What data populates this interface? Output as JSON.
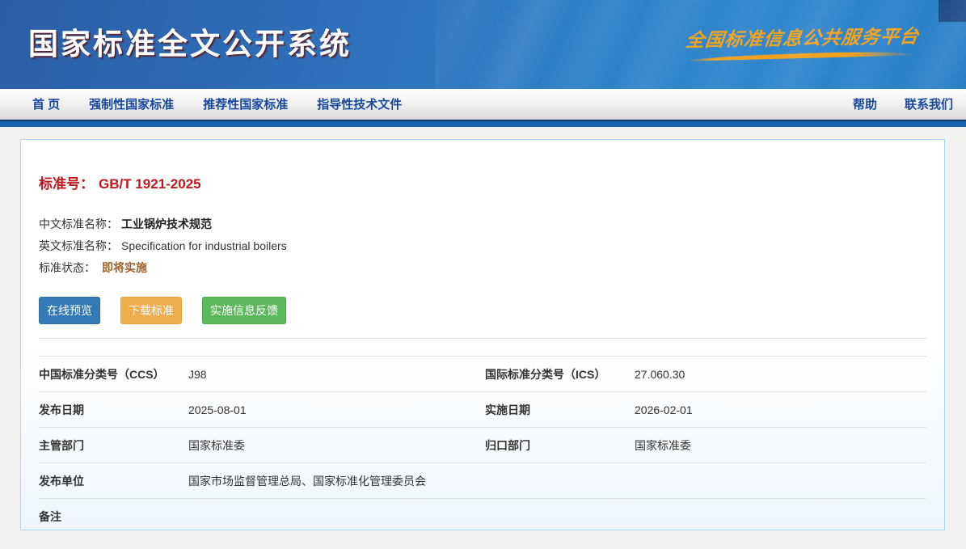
{
  "header": {
    "title": "国家标准全文公开系统",
    "platform_logo": "全国标准信息公共服务平台"
  },
  "nav": {
    "items": [
      {
        "label": "首 页"
      },
      {
        "label": "强制性国家标准"
      },
      {
        "label": "推荐性国家标准"
      },
      {
        "label": "指导性技术文件"
      }
    ],
    "right_items": [
      {
        "label": "帮助"
      },
      {
        "label": "联系我们"
      }
    ]
  },
  "standard": {
    "number_label": "标准号：",
    "number": "GB/T 1921-2025",
    "cn_name_label": "中文标准名称：",
    "cn_name": "工业锅炉技术规范",
    "en_name_label": "英文标准名称：",
    "en_name": "Specification for industrial boilers",
    "status_label": "标准状态：",
    "status": "即将实施"
  },
  "actions": {
    "preview": "在线预览",
    "download": "下载标准",
    "feedback": "实施信息反馈"
  },
  "details": {
    "rows": [
      {
        "left": {
          "label": "中国标准分类号（CCS）",
          "value": "J98"
        },
        "right": {
          "label": "国际标准分类号（ICS）",
          "value": "27.060.30"
        }
      },
      {
        "left": {
          "label": "发布日期",
          "value": "2025-08-01"
        },
        "right": {
          "label": "实施日期",
          "value": "2026-02-01"
        }
      },
      {
        "left": {
          "label": "主管部门",
          "value": "国家标准委"
        },
        "right": {
          "label": "归口部门",
          "value": "国家标准委"
        }
      },
      {
        "left": {
          "label": "发布单位",
          "value": "国家市场监督管理总局、国家标准化管理委员会"
        }
      },
      {
        "left": {
          "label": "备注",
          "value": ""
        }
      }
    ]
  },
  "colors": {
    "accent_red": "#c3161c",
    "status_orange": "#a0622d",
    "nav_blue": "#17479e",
    "logo_gold": "#f2a31d",
    "button_blue": "#337ab7",
    "button_orange": "#f0ad4e",
    "button_green": "#5cb85c"
  }
}
